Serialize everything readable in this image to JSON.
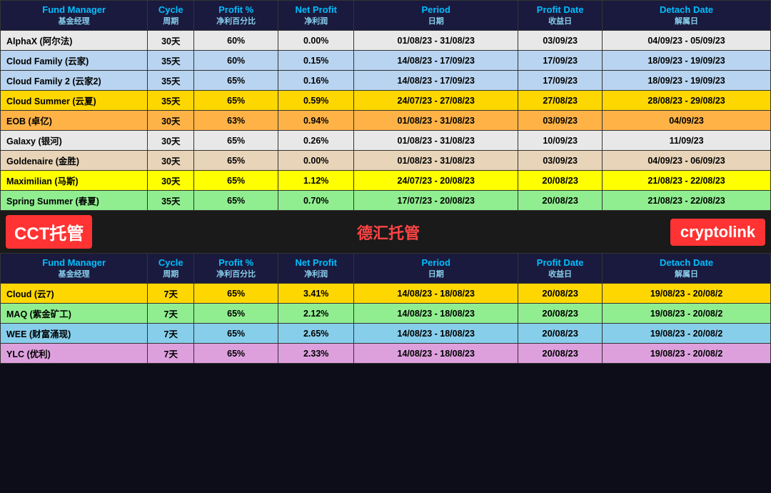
{
  "top_table": {
    "headers": [
      {
        "en": "Fund Manager",
        "zh": "基金经理"
      },
      {
        "en": "Cycle",
        "zh": "周期"
      },
      {
        "en": "Profit %",
        "zh": "净利百分比"
      },
      {
        "en": "Net Profit",
        "zh": "净利润"
      },
      {
        "en": "Period",
        "zh": "日期"
      },
      {
        "en": "Profit Date",
        "zh": "收益日"
      },
      {
        "en": "Detach Date",
        "zh": "解属日"
      }
    ],
    "rows": [
      {
        "name": "AlphaX (阿尔法)",
        "cycle": "30天",
        "profit_pct": "60%",
        "net_profit": "0.00%",
        "period": "01/08/23 - 31/08/23",
        "profit_date": "03/09/23",
        "detach_date": "04/09/23 - 05/09/23",
        "style": "row-alphax",
        "bold_date": false
      },
      {
        "name": "Cloud Family (云家)",
        "cycle": "35天",
        "profit_pct": "60%",
        "net_profit": "0.15%",
        "period": "14/08/23 - 17/09/23",
        "profit_date": "17/09/23",
        "detach_date": "18/09/23 - 19/09/23",
        "style": "row-cloud-family",
        "bold_date": false
      },
      {
        "name": "Cloud Family 2 (云家2)",
        "cycle": "35天",
        "profit_pct": "65%",
        "net_profit": "0.16%",
        "period": "14/08/23 - 17/09/23",
        "profit_date": "17/09/23",
        "detach_date": "18/09/23 - 19/09/23",
        "style": "row-cloud-family2",
        "bold_date": false
      },
      {
        "name": "Cloud Summer (云夏)",
        "cycle": "35天",
        "profit_pct": "65%",
        "net_profit": "0.59%",
        "period": "24/07/23 - 27/08/23",
        "profit_date": "27/08/23",
        "detach_date": "28/08/23 - 29/08/23",
        "style": "row-cloud-summer",
        "bold_date": false
      },
      {
        "name": "EOB (卓亿)",
        "cycle": "30天",
        "profit_pct": "63%",
        "net_profit": "0.94%",
        "period": "01/08/23 - 31/08/23",
        "profit_date": "03/09/23",
        "detach_date": "04/09/23",
        "style": "row-eob",
        "bold_date": false
      },
      {
        "name": "Galaxy (银河)",
        "cycle": "30天",
        "profit_pct": "65%",
        "net_profit": "0.26%",
        "period": "01/08/23 - 31/08/23",
        "profit_date": "10/09/23",
        "detach_date": "11/09/23",
        "style": "row-galaxy",
        "bold_date": false
      },
      {
        "name": "Goldenaire (金胜)",
        "cycle": "30天",
        "profit_pct": "65%",
        "net_profit": "0.00%",
        "period": "01/08/23 - 31/08/23",
        "profit_date": "03/09/23",
        "detach_date": "04/09/23 - 06/09/23",
        "style": "row-goldenaire",
        "bold_date": false
      },
      {
        "name": "Maximilian (马斯)",
        "cycle": "30天",
        "profit_pct": "65%",
        "net_profit": "1.12%",
        "period": "24/07/23 - 20/08/23",
        "profit_date": "20/08/23",
        "detach_date": "21/08/23 - 22/08/23",
        "style": "row-maximilian",
        "bold_date": true
      },
      {
        "name": "Spring Summer (春夏)",
        "cycle": "35天",
        "profit_pct": "65%",
        "net_profit": "0.70%",
        "period": "17/07/23 - 20/08/23",
        "profit_date": "20/08/23",
        "detach_date": "21/08/23 - 22/08/23",
        "style": "row-spring-summer",
        "bold_date": true
      }
    ]
  },
  "middle": {
    "cct": "CCT托管",
    "dehui": "德汇托管",
    "cryptolink": "cryptolink"
  },
  "bottom_table": {
    "headers": [
      {
        "en": "Fund Manager",
        "zh": "基金经理"
      },
      {
        "en": "Cycle",
        "zh": "周期"
      },
      {
        "en": "Profit %",
        "zh": "净利百分比"
      },
      {
        "en": "Net Profit",
        "zh": "净利润"
      },
      {
        "en": "Period",
        "zh": "日期"
      },
      {
        "en": "Profit Date",
        "zh": "收益日"
      },
      {
        "en": "Detach Date",
        "zh": "解属日"
      }
    ],
    "rows": [
      {
        "name": "Cloud (云7)",
        "cycle": "7天",
        "profit_pct": "65%",
        "net_profit": "3.41%",
        "period": "14/08/23 - 18/08/23",
        "profit_date": "20/08/23",
        "detach_date": "19/08/23 - 20/08/2",
        "style": "row-cloud7",
        "bold_date": true
      },
      {
        "name": "MAQ (紫金矿工)",
        "cycle": "7天",
        "profit_pct": "65%",
        "net_profit": "2.12%",
        "period": "14/08/23 - 18/08/23",
        "profit_date": "20/08/23",
        "detach_date": "19/08/23 - 20/08/2",
        "style": "row-maq",
        "bold_date": true
      },
      {
        "name": "WEE (财富涌现)",
        "cycle": "7天",
        "profit_pct": "65%",
        "net_profit": "2.65%",
        "period": "14/08/23 - 18/08/23",
        "profit_date": "20/08/23",
        "detach_date": "19/08/23 - 20/08/2",
        "style": "row-wee",
        "bold_date": true
      },
      {
        "name": "YLC (优利)",
        "cycle": "7天",
        "profit_pct": "65%",
        "net_profit": "2.33%",
        "period": "14/08/23 - 18/08/23",
        "profit_date": "20/08/23",
        "detach_date": "19/08/23 - 20/08/2",
        "style": "row-ylc",
        "bold_date": true
      }
    ]
  }
}
